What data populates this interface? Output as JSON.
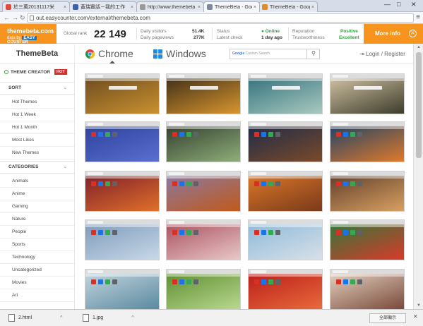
{
  "browser": {
    "tabs": [
      {
        "title": "於三萬20131117米",
        "active": false,
        "favicon": "#e14b3b"
      },
      {
        "title": "蓋瑞實話－我的工作",
        "active": false,
        "favicon": "#3a5fb0"
      },
      {
        "title": "http://www.themebeta",
        "active": false,
        "favicon": "#9a9a9a"
      },
      {
        "title": "ThemeBeta - Google C",
        "active": true,
        "favicon": "#7d8a9e"
      },
      {
        "title": "ThemeBeta - Google C",
        "active": false,
        "favicon": "#e08a2a"
      }
    ],
    "window_controls": [
      "—",
      "□",
      "✕"
    ],
    "url": "out.easycounter.com/external/themebeta.com",
    "menu_icon": "hamburger-icon"
  },
  "easycounter": {
    "brand_name": "themebeta.com",
    "brand_data_by": "data by",
    "brand_easy": "EASY",
    "brand_counter": "COUNTER",
    "global_rank_label": "Global rank",
    "global_rank_value": "22 149",
    "daily_visitors_label": "Daily visitors",
    "daily_visitors_value": "51.4K",
    "daily_pageviews_label": "Daily pageviews",
    "daily_pageviews_value": "277K",
    "status_label": "Status",
    "status_value": "Online",
    "latest_check_label": "Latest check",
    "latest_check_value": "1 day ago",
    "reputation_label": "Reputation",
    "reputation_value": "Positive",
    "trustworthiness_label": "Trustworthiness",
    "trustworthiness_value": "Excellent",
    "more_info": "More info",
    "close_icon": "✕"
  },
  "site": {
    "logo": "ThemeBeta",
    "platforms": [
      {
        "label": "Chrome",
        "selected": true
      },
      {
        "label": "Windows",
        "selected": false
      }
    ],
    "search_google": "Google",
    "search_placeholder": "Custom Search",
    "search_icon": "search-icon",
    "login": "Login / Register"
  },
  "sidebar": {
    "theme_creator": "THEME CREATOR",
    "hot_badge": "HOT",
    "sort_heading": "SORT",
    "sort_items": [
      "Hot Themes",
      "Hot 1 Week",
      "Hot 1 Month",
      "Most Likes",
      "New Themes"
    ],
    "categories_heading": "CATEGORIES",
    "category_items": [
      "Animals",
      "Anime",
      "Gaming",
      "Nature",
      "People",
      "Sports",
      "Technology",
      "Uncategorized",
      "Movies",
      "Art"
    ]
  },
  "themes": [
    {
      "c1": "#6b4a1f",
      "c2": "#c9902f",
      "dark": false
    },
    {
      "c1": "#3a2a18",
      "c2": "#d8962e",
      "dark": false
    },
    {
      "c1": "#2f6f7a",
      "c2": "#a9c9c0",
      "dark": false
    },
    {
      "c1": "#d8c8a8",
      "c2": "#3c3c2c",
      "dark": false
    },
    {
      "c1": "#2b3f9a",
      "c2": "#5a6fd0",
      "dark": false
    },
    {
      "c1": "#2e3a2a",
      "c2": "#8fae7a",
      "dark": false
    },
    {
      "c1": "#1a2a4a",
      "c2": "#7a4a2a",
      "dark": false
    },
    {
      "c1": "#16406a",
      "c2": "#e07a2a",
      "dark": false
    },
    {
      "c1": "#7a1a2a",
      "c2": "#e0702a",
      "dark": false
    },
    {
      "c1": "#8a7aa8",
      "c2": "#c05a1a",
      "dark": false
    },
    {
      "c1": "#e07a2a",
      "c2": "#7a3a1a",
      "dark": false
    },
    {
      "c1": "#5a3a2a",
      "c2": "#d8a060",
      "dark": false
    },
    {
      "c1": "#7a98b8",
      "c2": "#c8d8e8",
      "dark": false
    },
    {
      "c1": "#a84a5a",
      "c2": "#e8c8c8",
      "dark": false
    },
    {
      "c1": "#8ab8d8",
      "c2": "#d8e0e8",
      "dark": false
    },
    {
      "c1": "#2a7a3a",
      "c2": "#d83a2a",
      "dark": false
    },
    {
      "c1": "#c8d8e0",
      "c2": "#5a8aa0",
      "dark": false
    },
    {
      "c1": "#5a8a2a",
      "c2": "#b8d890",
      "dark": false
    },
    {
      "c1": "#b81a1a",
      "c2": "#e86a3a",
      "dark": false
    },
    {
      "c1": "#e8d8c8",
      "c2": "#7a4a3a",
      "dark": false
    }
  ],
  "downloads": [
    {
      "name": "2.html",
      "chevron": "^"
    },
    {
      "name": "1.jpg",
      "chevron": "^"
    }
  ],
  "download_show_all": "全部顯示",
  "download_close": "✕"
}
